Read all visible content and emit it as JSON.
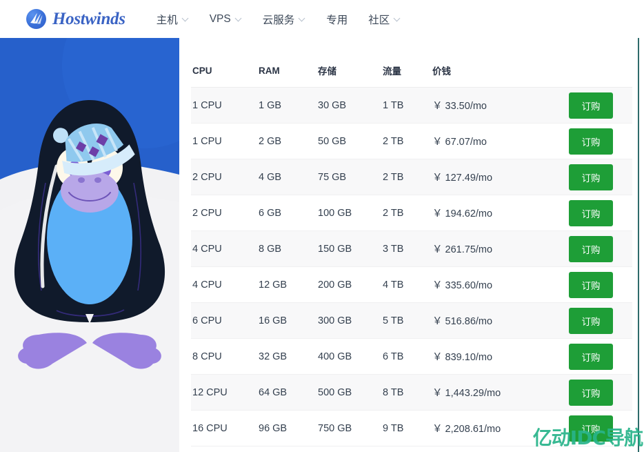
{
  "brand": {
    "name": "Hostwinds",
    "logo_icon": "hostwinds-swoosh-icon",
    "color": "#3a63c4"
  },
  "nav": {
    "items": [
      {
        "label": "主机",
        "has_dropdown": true,
        "icon": "chevron-down-icon"
      },
      {
        "label": "VPS",
        "has_dropdown": true,
        "icon": "chevron-down-icon"
      },
      {
        "label": "云服务",
        "has_dropdown": true,
        "icon": "chevron-down-icon"
      },
      {
        "label": "专用",
        "has_dropdown": false,
        "icon": ""
      },
      {
        "label": "社区",
        "has_dropdown": true,
        "icon": "chevron-down-icon"
      }
    ]
  },
  "hero": {
    "illustration": "linux-tux-penguin-with-winter-hat",
    "background_color": "#2660cb",
    "snow_color": "#f2f2f4",
    "penguin_body_color": "#101a2b",
    "penguin_belly_color": "#5bb0f7",
    "penguin_feet_color": "#9a82e0",
    "hat_color": "#a8d5f2"
  },
  "table": {
    "columns": [
      "CPU",
      "RAM",
      "存储",
      "流量",
      "价钱",
      ""
    ],
    "action_label": "订购",
    "action_color": "#1e9e37",
    "rows": [
      {
        "cpu": "1 CPU",
        "ram": "1 GB",
        "storage": "30 GB",
        "bandwidth": "1 TB",
        "price": "￥ 33.50/mo",
        "action": "订购"
      },
      {
        "cpu": "1 CPU",
        "ram": "2 GB",
        "storage": "50 GB",
        "bandwidth": "2 TB",
        "price": "￥ 67.07/mo",
        "action": "订购"
      },
      {
        "cpu": "2 CPU",
        "ram": "4 GB",
        "storage": "75 GB",
        "bandwidth": "2 TB",
        "price": "￥ 127.49/mo",
        "action": "订购"
      },
      {
        "cpu": "2 CPU",
        "ram": "6 GB",
        "storage": "100 GB",
        "bandwidth": "2 TB",
        "price": "￥ 194.62/mo",
        "action": "订购"
      },
      {
        "cpu": "4 CPU",
        "ram": "8 GB",
        "storage": "150 GB",
        "bandwidth": "3 TB",
        "price": "￥ 261.75/mo",
        "action": "订购"
      },
      {
        "cpu": "4 CPU",
        "ram": "12 GB",
        "storage": "200 GB",
        "bandwidth": "4 TB",
        "price": "￥ 335.60/mo",
        "action": "订购"
      },
      {
        "cpu": "6 CPU",
        "ram": "16 GB",
        "storage": "300 GB",
        "bandwidth": "5 TB",
        "price": "￥ 516.86/mo",
        "action": "订购"
      },
      {
        "cpu": "8 CPU",
        "ram": "32 GB",
        "storage": "400 GB",
        "bandwidth": "6 TB",
        "price": "￥ 839.10/mo",
        "action": "订购"
      },
      {
        "cpu": "12 CPU",
        "ram": "64 GB",
        "storage": "500 GB",
        "bandwidth": "8 TB",
        "price": "￥ 1,443.29/mo",
        "action": "订购"
      },
      {
        "cpu": "16 CPU",
        "ram": "96 GB",
        "storage": "750 GB",
        "bandwidth": "9 TB",
        "price": "￥ 2,208.61/mo",
        "action": "订购"
      }
    ]
  },
  "watermark": {
    "text": "亿动IDC导航",
    "color": "#28b48a"
  }
}
